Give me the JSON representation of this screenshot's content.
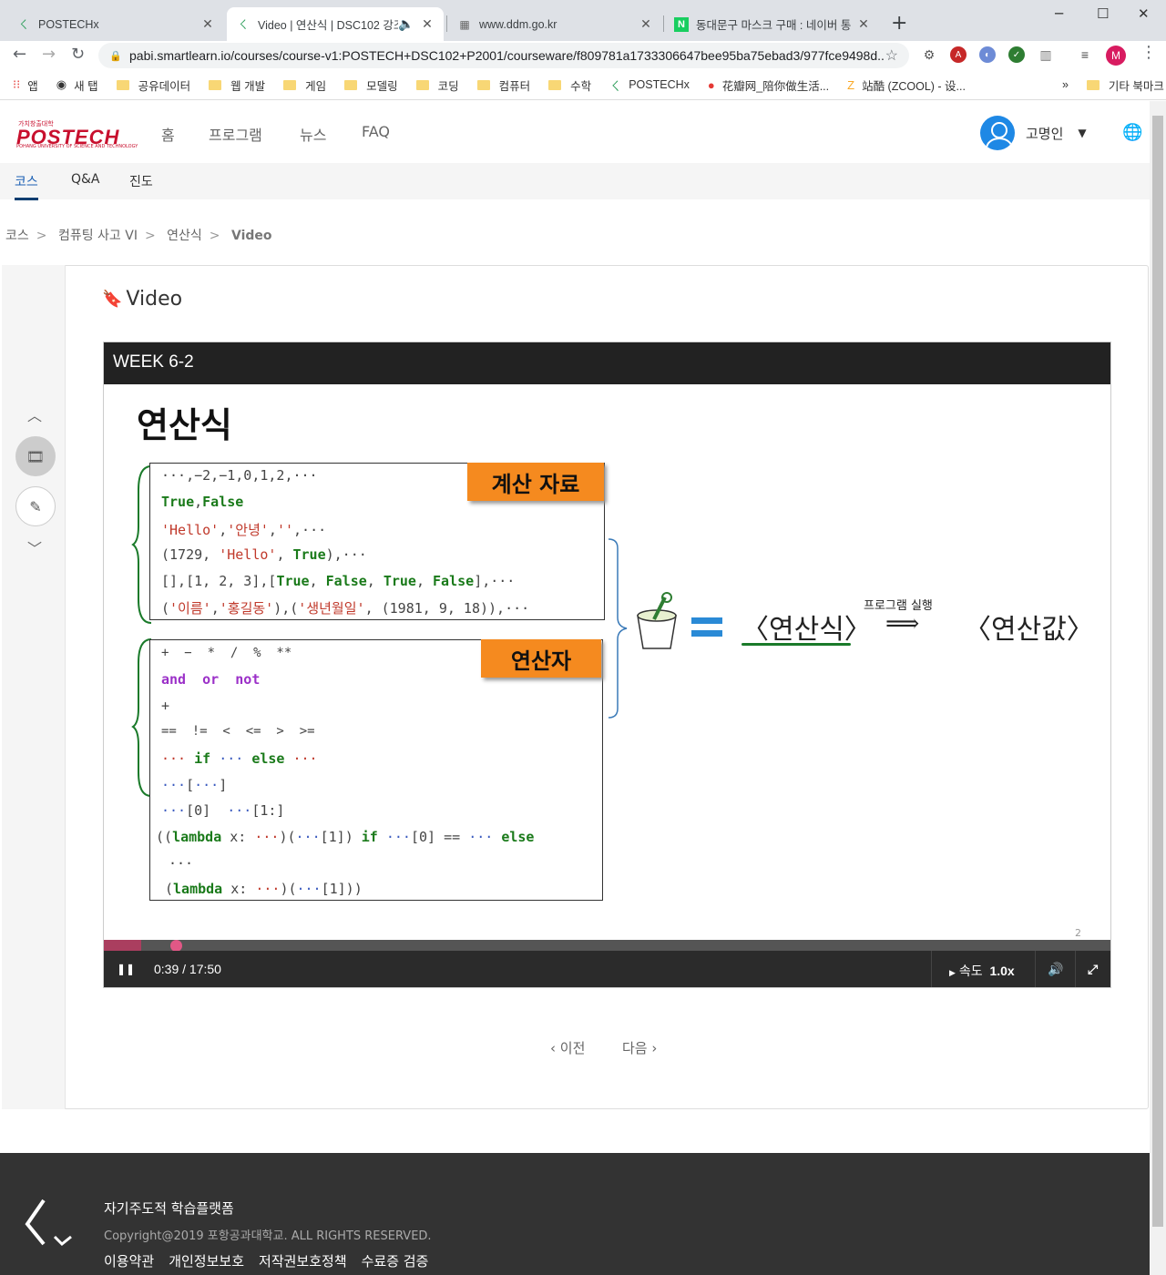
{
  "browser": {
    "tabs": [
      {
        "title": "POSTECHx",
        "active": false
      },
      {
        "title": "Video | 연산식 | DSC102 강조",
        "active": true
      },
      {
        "title": "www.ddm.go.kr",
        "active": false
      },
      {
        "title": "동대문구 마스크 구매 : 네이버 통",
        "active": false
      }
    ],
    "url": "pabi.smartlearn.io/courses/course-v1:POSTECH+DSC102+P2001/courseware/f809781a1733306647bee95ba75ebad3/977fce9498d...",
    "profile_initial": "M",
    "bookmarks": [
      "앱",
      "새 탭",
      "공유데이터",
      "웹 개발",
      "게임",
      "모델링",
      "코딩",
      "컴퓨터",
      "수학",
      "POSTECHx",
      "花瓣网_陪你做生活...",
      "站酷 (ZCOOL) - 设...",
      "»",
      "기타 북마크"
    ]
  },
  "header": {
    "logo_top": "가치창출대학",
    "logo": "POSTECH",
    "logo_sub": "POHANG UNIVERSITY OF SCIENCE AND TECHNOLOGY",
    "nav": [
      "홈",
      "프로그램",
      "뉴스",
      "FAQ"
    ],
    "user_name": "고명인"
  },
  "subnav": [
    "코스",
    "Q&A",
    "진도"
  ],
  "breadcrumb": [
    "코스",
    "컴퓨팅 사고 VI",
    "연산식",
    "Video"
  ],
  "unit_title": "Video",
  "video": {
    "header": "WEEK 6-2",
    "time": "0:39 / 17:50",
    "progress": 0.037,
    "speed_label": "속도",
    "speed_value": "1.0x",
    "slide_number": "2"
  },
  "slide": {
    "title": "연산식",
    "badge1": "계산 자료",
    "badge2": "연산자",
    "run_label": "프로그램 실행",
    "expr": "〈연산식〉",
    "value": "〈연산값〉"
  },
  "pager": {
    "prev": "이전",
    "next": "다음"
  },
  "footer": {
    "title": "자기주도적 학습플랫폼",
    "copyright": "Copyright@2019 포항공과대학교. ALL RIGHTS RESERVED.",
    "links": [
      "이용약관",
      "개인정보보호",
      "저작권보호정책",
      "수료증 검증"
    ]
  }
}
